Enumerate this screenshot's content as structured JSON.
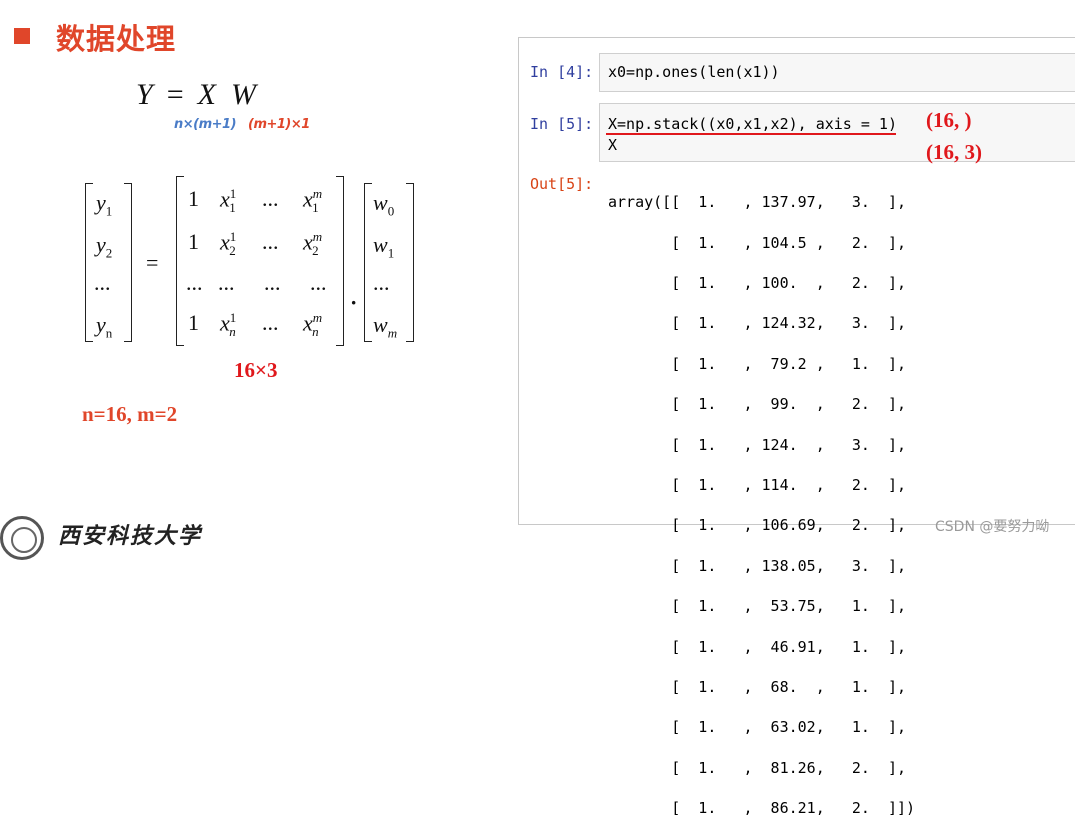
{
  "slide": {
    "title": "数据处理",
    "equation": {
      "Y": "Y",
      "eq": "=",
      "X": "X",
      "W": "W",
      "dim_x": "n×(m+1)",
      "dim_w": "(m+1)×1"
    },
    "matrix": {
      "y": [
        "y",
        "y",
        "...",
        "y"
      ],
      "y_sub": [
        "1",
        "2",
        "",
        "n"
      ],
      "x_rows": [
        [
          "1",
          "x",
          "...",
          "x"
        ],
        [
          "1",
          "x",
          "...",
          "x"
        ],
        [
          "...",
          "...",
          "...",
          "..."
        ],
        [
          "1",
          "x",
          "...",
          "x"
        ]
      ],
      "x_subs": [
        "1",
        "2",
        "",
        "n"
      ],
      "w": [
        "w",
        "w",
        "...",
        "w"
      ],
      "w_sub": [
        "0",
        "1",
        "",
        "m"
      ],
      "sup1": "1",
      "supm": "m",
      "dot": "·",
      "equals": "="
    },
    "shape_label": "16×3",
    "nm_label": "n=16,  m=2",
    "university": "西安科技大学"
  },
  "notebook": {
    "cells": [
      {
        "prompt": "In [4]:",
        "code": "x0=np.ones(len(x1))"
      },
      {
        "prompt": "In [5]:",
        "code_line1": "X=np.stack((x0,x1,x2), axis = 1)",
        "code_line2": "X"
      }
    ],
    "annotation_top": "(16, )",
    "annotation_bottom": "(16, 3)",
    "output_prompt": "Out[5]:",
    "output_lines": [
      "array([[  1.   , 137.97,   3.  ],",
      "       [  1.   , 104.5 ,   2.  ],",
      "       [  1.   , 100.  ,   2.  ],",
      "       [  1.   , 124.32,   3.  ],",
      "       [  1.   ,  79.2 ,   1.  ],",
      "       [  1.   ,  99.  ,   2.  ],",
      "       [  1.   , 124.  ,   3.  ],",
      "       [  1.   , 114.  ,   2.  ],",
      "       [  1.   , 106.69,   2.  ],",
      "       [  1.   , 138.05,   3.  ],",
      "       [  1.   ,  53.75,   1.  ],",
      "       [  1.   ,  46.91,   1.  ],",
      "       [  1.   ,  68.  ,   1.  ],",
      "       [  1.   ,  63.02,   1.  ],",
      "       [  1.   ,  81.26,   2.  ],",
      "       [  1.   ,  86.21,   2.  ]])"
    ]
  },
  "watermark": "CSDN @要努力呦"
}
